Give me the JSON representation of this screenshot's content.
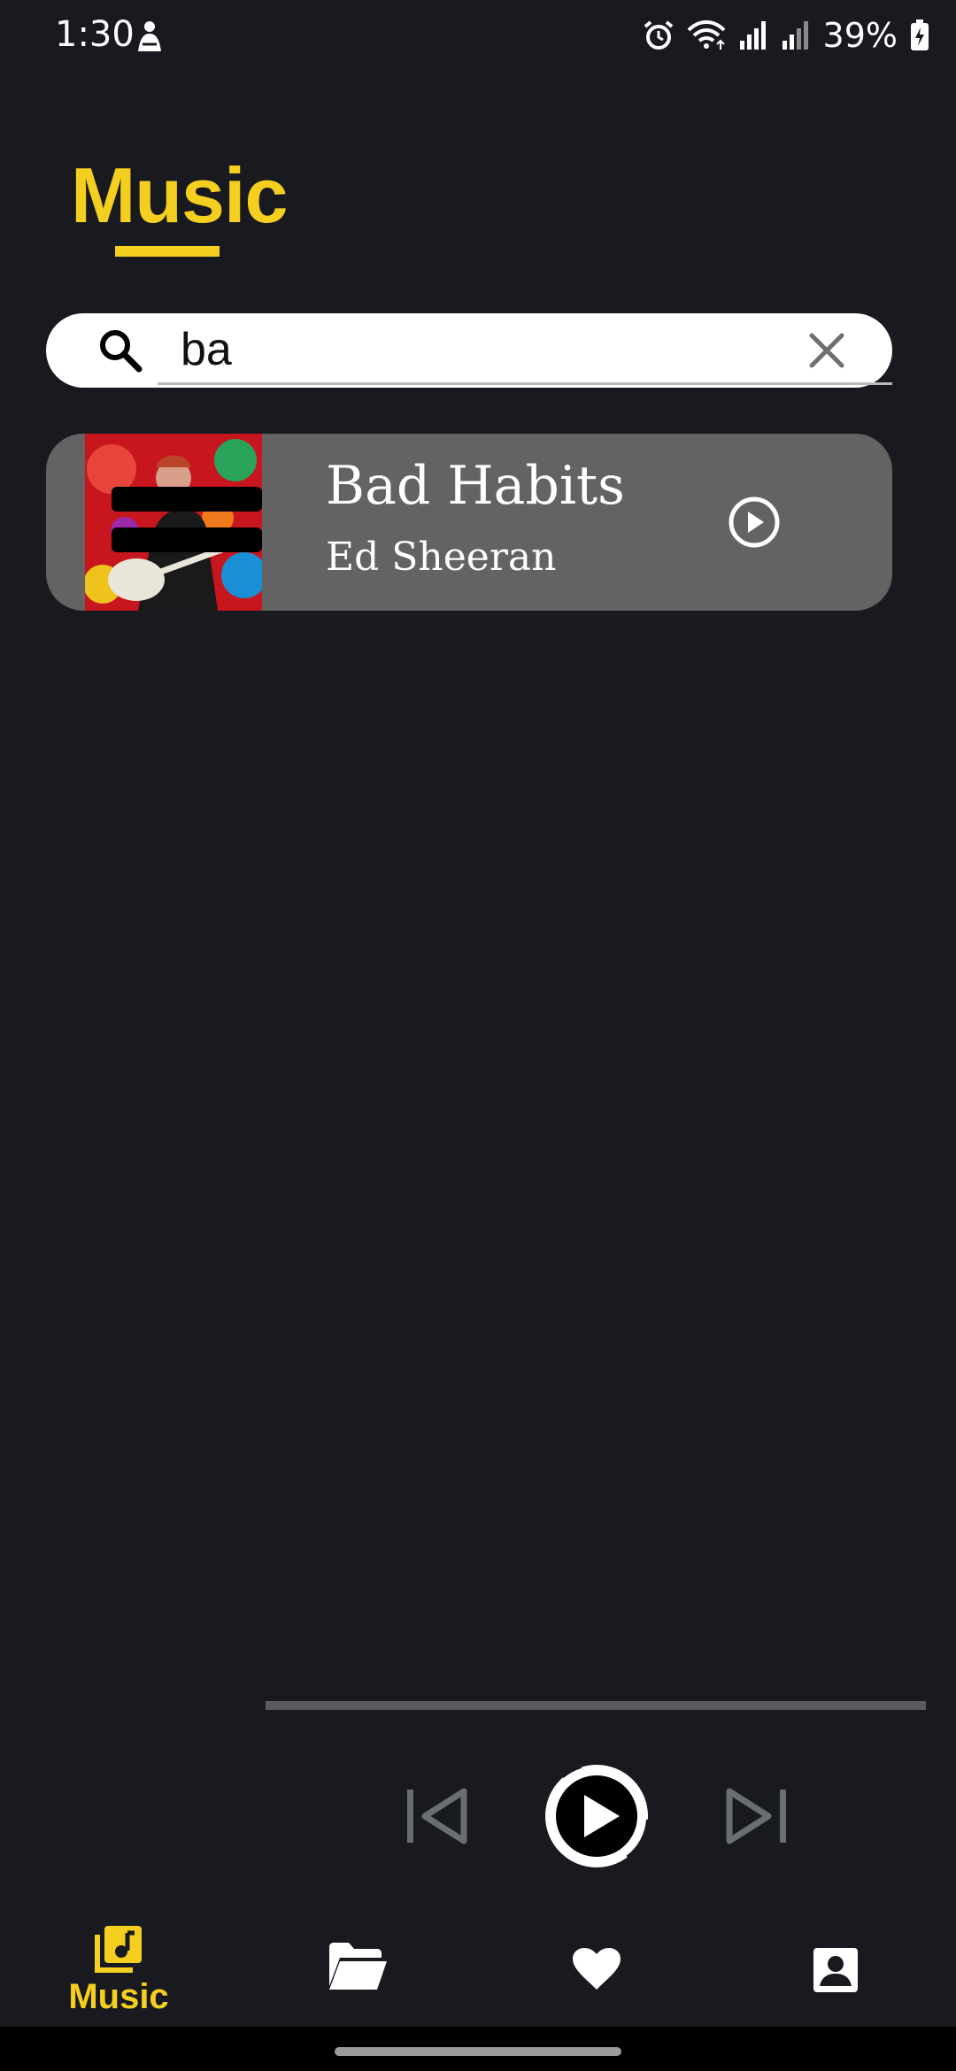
{
  "status_bar": {
    "time": "1:30",
    "battery": "39%",
    "icons": [
      "person-notification-icon",
      "alarm-icon",
      "wifi-icon",
      "signal-icon",
      "signal-icon",
      "battery-charging-icon"
    ]
  },
  "header": {
    "title": "Music"
  },
  "search": {
    "value": "ba",
    "icon": "search-icon",
    "clear_icon": "close-icon"
  },
  "results": [
    {
      "title": "Bad Habits",
      "artist": "Ed Sheeran",
      "action_icon": "play-circle-icon"
    }
  ],
  "player": {
    "progress": 0,
    "controls": [
      "skip-previous-icon",
      "play-icon",
      "skip-next-icon"
    ]
  },
  "bottom_nav": {
    "items": [
      {
        "label": "Music",
        "icon": "music-library-icon",
        "active": true
      },
      {
        "label": "",
        "icon": "folder-open-icon",
        "active": false
      },
      {
        "label": "",
        "icon": "heart-icon",
        "active": false
      },
      {
        "label": "",
        "icon": "account-box-icon",
        "active": false
      }
    ]
  },
  "colors": {
    "background": "#181a1f",
    "accent": "#f5cf1f",
    "card": "#636363",
    "track": "#595b60"
  }
}
